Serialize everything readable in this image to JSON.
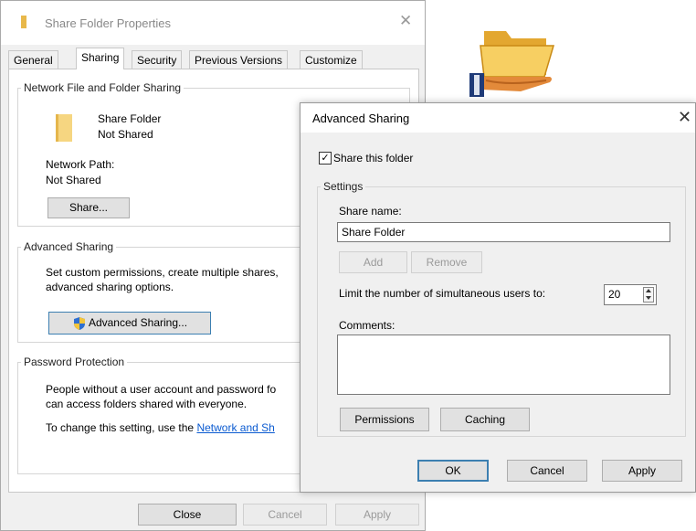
{
  "properties": {
    "title": "Share Folder Properties",
    "tabs": [
      {
        "label": "General"
      },
      {
        "label": "Sharing"
      },
      {
        "label": "Security"
      },
      {
        "label": "Previous Versions"
      },
      {
        "label": "Customize"
      }
    ],
    "network_sharing": {
      "legend": "Network File and Folder Sharing",
      "folder_name": "Share Folder",
      "status": "Not Shared",
      "path_label": "Network Path:",
      "path_value": "Not Shared",
      "share_button": "Share..."
    },
    "advanced_sharing": {
      "legend": "Advanced Sharing",
      "description_line1": "Set custom permissions, create multiple shares,",
      "description_line2": "advanced sharing options.",
      "button": "Advanced Sharing..."
    },
    "password_protection": {
      "legend": "Password Protection",
      "text_line1": "People without a user account and password fo",
      "text_line2": "can access folders shared with everyone.",
      "change_text": "To change this setting, use the ",
      "link_text": "Network and Sh"
    },
    "buttons": {
      "close": "Close",
      "cancel": "Cancel",
      "apply": "Apply"
    }
  },
  "dialog": {
    "title": "Advanced Sharing",
    "close_glyph": "✕",
    "share_checkbox_label": "Share this folder",
    "share_checked": true,
    "settings_legend": "Settings",
    "share_name_label": "Share name:",
    "share_name_value": "Share Folder",
    "add_label": "Add",
    "remove_label": "Remove",
    "limit_label": "Limit the number of simultaneous users to:",
    "limit_value": "20",
    "comments_label": "Comments:",
    "comments_value": "",
    "permissions_label": "Permissions",
    "caching_label": "Caching",
    "ok_label": "OK",
    "cancel_label": "Cancel",
    "apply_label": "Apply"
  },
  "icons": {
    "folder": "folder-icon",
    "shield": "uac-shield-icon",
    "shared_folder": "shared-folder-hand-icon"
  },
  "colors": {
    "link": "#0b5bd1",
    "focus_border": "#3c7fb1",
    "folder": "#f6d681"
  }
}
